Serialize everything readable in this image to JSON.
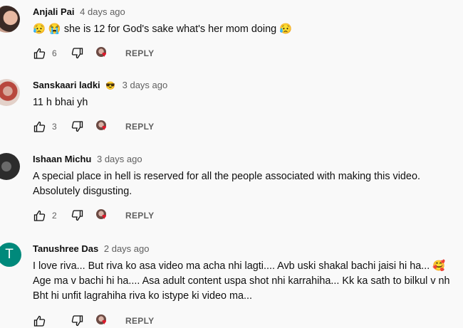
{
  "comments": [
    {
      "author": "Anjali Pai",
      "author_badge": "",
      "time": "4 days ago",
      "text_lines": [
        "😥 😭 she is 12 for God's sake what's her mom doing 😥"
      ],
      "likes": "6",
      "reply_label": "REPLY",
      "avatar_icon": "user-photo-avatar"
    },
    {
      "author": "Sanskaari ladki",
      "author_badge": "😎",
      "time": "3 days ago",
      "text_lines": [
        "11 h bhai yh"
      ],
      "likes": "3",
      "reply_label": "REPLY",
      "avatar_icon": "user-photo-avatar"
    },
    {
      "author": "Ishaan Michu",
      "author_badge": "",
      "time": "3 days ago",
      "text_lines": [
        "A special place in hell is reserved for all the people associated with making this video.",
        "Absolutely disgusting."
      ],
      "likes": "2",
      "reply_label": "REPLY",
      "avatar_icon": "user-photo-avatar"
    },
    {
      "author": "Tanushree Das",
      "author_badge": "",
      "avatar_letter": "T",
      "time": "2 days ago",
      "text_lines": [
        "I love  riva... But riva ko asa video ma acha nhi lagti.... Avb uski shakal bachi jaisi hi ha... 🥰",
        "Age ma v bachi hi ha.... Asa adult content  uspa shot nhi karrahiha... Kk ka sath to bilkul v nh",
        "Bht hi unfit lagrahiha riva ko istype ki video ma..."
      ],
      "likes": "",
      "reply_label": "REPLY",
      "avatar_icon": "letter-avatar"
    }
  ],
  "colors": {
    "background": "#f9f9f9",
    "heart": "#e0182b",
    "letter_avatar": "#00897b"
  }
}
